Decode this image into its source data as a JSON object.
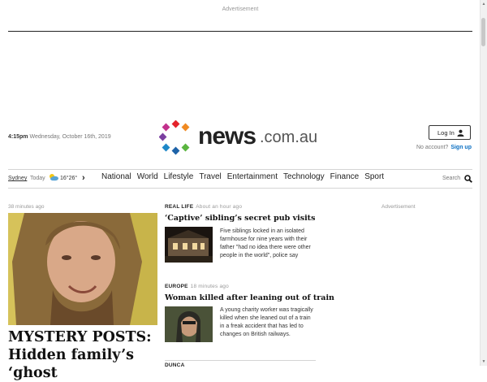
{
  "ad_top": {
    "label": "Advertisement"
  },
  "header": {
    "time": "4:15pm",
    "date": "Wednesday, October 16th, 2019",
    "logo": {
      "brand": "news",
      "suffix": ".com.au"
    },
    "login_label": "Log In",
    "no_account_text": "No account?",
    "signup_label": "Sign up"
  },
  "weather": {
    "location": "Sydney",
    "day": "Today",
    "temp": "16°26°",
    "icon": "partly-cloudy-icon"
  },
  "nav": {
    "items": [
      "National",
      "World",
      "Lifestyle",
      "Travel",
      "Entertainment",
      "Technology",
      "Finance",
      "Sport"
    ],
    "search_label": "Search"
  },
  "hero": {
    "time": "38 minutes ago",
    "headline_line1": "MYSTERY POSTS:",
    "headline_line2": "Hidden family’s ‘ghost"
  },
  "stories": [
    {
      "category": "REAL LIFE",
      "time": "About an hour ago",
      "title": "‘Captive’ sibling’s secret pub visits",
      "body": "Five siblings locked in an isolated farmhouse for nine years with their father \"had no idea there were other people in the world\", police say"
    },
    {
      "category": "EUROPE",
      "time": "18 minutes ago",
      "title": "Woman killed after leaning out of train",
      "body": "A young charity worker was tragically killed when she leaned out of a train in a freak accident that has led to changes on British railways."
    },
    {
      "category": "DUNCA",
      "time": "",
      "title": "",
      "body": ""
    }
  ],
  "ad_right": {
    "label": "Advertisement"
  },
  "colors": {
    "accent_link": "#0a6fc2",
    "text": "#222222",
    "muted": "#777777"
  }
}
